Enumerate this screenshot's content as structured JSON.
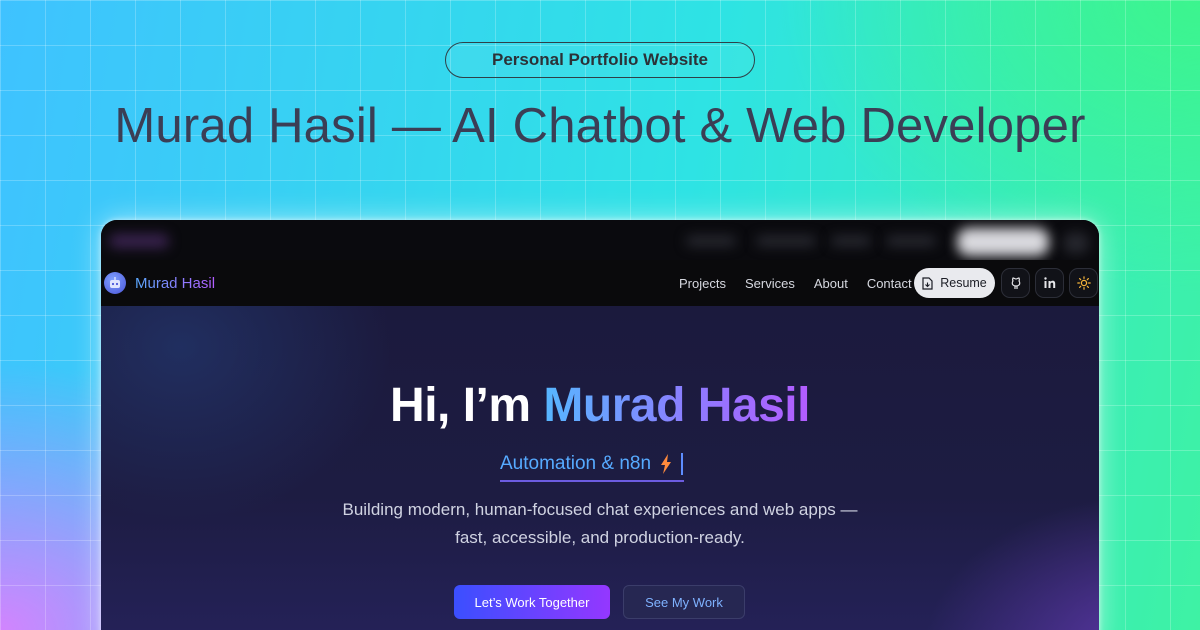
{
  "badge": {
    "label": "Personal Portfolio Website"
  },
  "headline": {
    "text": "Murad Hasil — AI Chatbot & Web Developer"
  },
  "site": {
    "brand": {
      "name": "Murad Hasil",
      "logo_icon": "robot-icon"
    },
    "nav": {
      "links": [
        {
          "label": "Projects"
        },
        {
          "label": "Services"
        },
        {
          "label": "About"
        },
        {
          "label": "Contact"
        }
      ],
      "resume_label": "Resume",
      "resume_icon": "document-icon",
      "icons": [
        "github-icon",
        "linkedin-icon",
        "sun-icon"
      ]
    },
    "hero": {
      "greeting": "Hi, I’m",
      "name": "Murad Hasil",
      "typed_text": "Automation & n8n",
      "typed_emoji": "lightning-bolt-icon",
      "tagline_line1": "Building modern, human-focused chat experiences and web apps —",
      "tagline_line2": "fast, accessible, and production-ready.",
      "primary_cta": "Let’s Work Together",
      "secondary_cta": "See My Work"
    }
  },
  "colors": {
    "accent_blue": "#56b7ff",
    "accent_purple": "#b35cff",
    "hero_bg": "#1d1c42",
    "headline": "#3b3e55"
  }
}
